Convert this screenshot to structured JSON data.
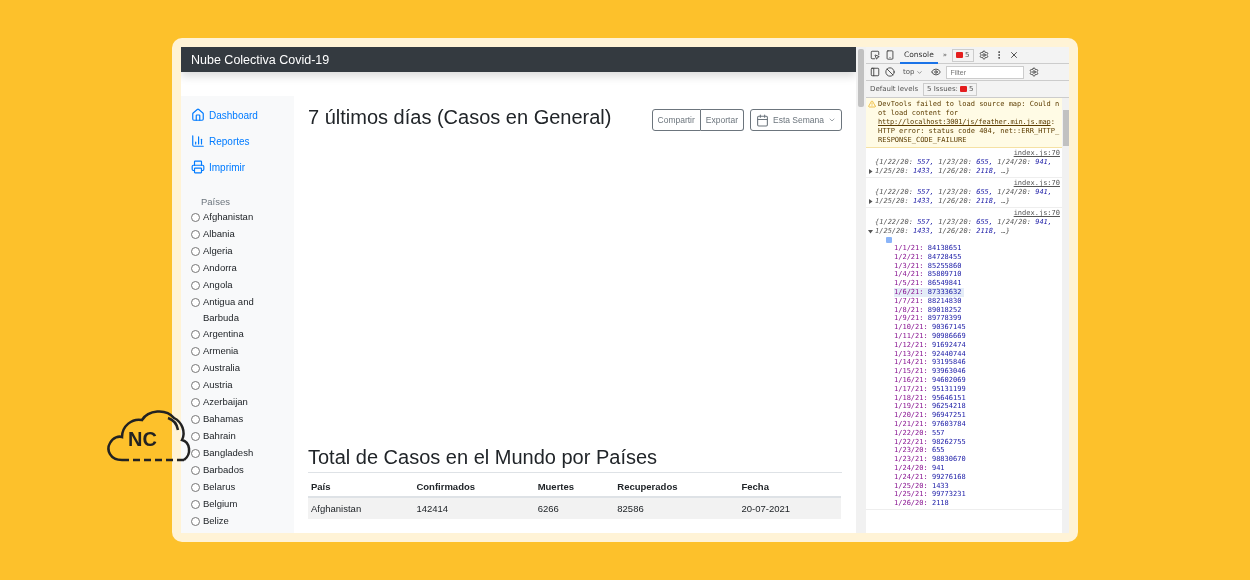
{
  "app": {
    "title": "Nube Colectiva Covid-19",
    "nav": [
      {
        "kind": "home",
        "label": "Dashboard"
      },
      {
        "kind": "chart",
        "label": "Reportes"
      },
      {
        "kind": "print",
        "label": "Imprimir"
      }
    ],
    "countries_heading": "Países",
    "countries": [
      {
        "name": "Afghanistan",
        "selected": false
      },
      {
        "name": "Albania",
        "selected": false
      },
      {
        "name": "Algeria",
        "selected": false
      },
      {
        "name": "Andorra",
        "selected": false
      },
      {
        "name": "Angola",
        "selected": false
      },
      {
        "name": "Antigua and Barbuda",
        "selected": false
      },
      {
        "name": "Argentina",
        "selected": false
      },
      {
        "name": "Armenia",
        "selected": false
      },
      {
        "name": "Australia",
        "selected": false
      },
      {
        "name": "Austria",
        "selected": false
      },
      {
        "name": "Azerbaijan",
        "selected": false
      },
      {
        "name": "Bahamas",
        "selected": false
      },
      {
        "name": "Bahrain",
        "selected": false
      },
      {
        "name": "Bangladesh",
        "selected": false
      },
      {
        "name": "Barbados",
        "selected": false
      },
      {
        "name": "Belarus",
        "selected": false
      },
      {
        "name": "Belgium",
        "selected": false
      },
      {
        "name": "Belize",
        "selected": false
      }
    ],
    "chart_title": "7 últimos días (Casos en General)",
    "buttons": [
      "Compartir",
      "Exportar"
    ],
    "range_dropdown": "Esta Semana",
    "table_title": "Total de Casos en el Mundo por Países",
    "table": {
      "columns": [
        "País",
        "Confirmados",
        "Muertes",
        "Recuperados",
        "Fecha"
      ],
      "rows": [
        [
          "Afghanistan",
          "142414",
          "6266",
          "82586",
          "20-07-2021"
        ]
      ]
    }
  },
  "devtools": {
    "tabs": [
      {
        "label": "Console",
        "selected": true
      }
    ],
    "more_tabs": "»",
    "error_count": "5",
    "context": "top",
    "filter_placeholder": "Filter",
    "levels": "Default levels",
    "issues_label": "5 Issues:",
    "issues_count": "5",
    "warning": {
      "text_before": "DevTools failed to load source map: Could not load content for ",
      "link": "http://localhost:3001/js/feather.min.js.map",
      "text_after": ": HTTP error: status code 404, net::ERR_HTTP_RESPONSE_CODE_FAILURE"
    },
    "logs": [
      {
        "source": "index.js:70",
        "expanded": false,
        "preview": [
          {
            "key": "{1/22/20:",
            "value": "557,"
          },
          {
            "key": "1/23/20:",
            "value": "655,"
          },
          {
            "key": "1/24/20:",
            "value": "941,"
          },
          {
            "key": "1/25/20:",
            "value": "1433,"
          },
          {
            "key": "1/26/20:",
            "value": "2118,"
          }
        ],
        "rest": "…}"
      },
      {
        "source": "index.js:70",
        "expanded": false,
        "preview": [
          {
            "key": "{1/22/20:",
            "value": "557,"
          },
          {
            "key": "1/23/20:",
            "value": "655,"
          },
          {
            "key": "1/24/20:",
            "value": "941,"
          },
          {
            "key": "1/25/20:",
            "value": "1433,"
          },
          {
            "key": "1/26/20:",
            "value": "2118,"
          }
        ],
        "rest": "…}"
      },
      {
        "source": "index.js:70",
        "expanded": true,
        "preview": [
          {
            "key": "{1/22/20:",
            "value": "557,"
          },
          {
            "key": "1/23/20:",
            "value": "655,"
          },
          {
            "key": "1/24/20:",
            "value": "941,"
          },
          {
            "key": "1/25/20:",
            "value": "1433,"
          },
          {
            "key": "1/26/20:",
            "value": "2118,"
          }
        ],
        "rest": "…}"
      }
    ],
    "entries": [
      {
        "key": "1/1/21:",
        "value": "84138651",
        "selected": false
      },
      {
        "key": "1/2/21:",
        "value": "84728455",
        "selected": false
      },
      {
        "key": "1/3/21:",
        "value": "85255860",
        "selected": false
      },
      {
        "key": "1/4/21:",
        "value": "85809710",
        "selected": false
      },
      {
        "key": "1/5/21:",
        "value": "86549841",
        "selected": false
      },
      {
        "key": "1/6/21:",
        "value": "87333632",
        "selected": true
      },
      {
        "key": "1/7/21:",
        "value": "88214830",
        "selected": false
      },
      {
        "key": "1/8/21:",
        "value": "89018252",
        "selected": false
      },
      {
        "key": "1/9/21:",
        "value": "89778399",
        "selected": false
      },
      {
        "key": "1/10/21:",
        "value": "90367145",
        "selected": false
      },
      {
        "key": "1/11/21:",
        "value": "90986669",
        "selected": false
      },
      {
        "key": "1/12/21:",
        "value": "91692474",
        "selected": false
      },
      {
        "key": "1/13/21:",
        "value": "92440744",
        "selected": false
      },
      {
        "key": "1/14/21:",
        "value": "93195846",
        "selected": false
      },
      {
        "key": "1/15/21:",
        "value": "93963046",
        "selected": false
      },
      {
        "key": "1/16/21:",
        "value": "94602069",
        "selected": false
      },
      {
        "key": "1/17/21:",
        "value": "95131199",
        "selected": false
      },
      {
        "key": "1/18/21:",
        "value": "95646151",
        "selected": false
      },
      {
        "key": "1/19/21:",
        "value": "96254218",
        "selected": false
      },
      {
        "key": "1/20/21:",
        "value": "96947251",
        "selected": false
      },
      {
        "key": "1/21/21:",
        "value": "97603784",
        "selected": false
      },
      {
        "key": "1/22/20:",
        "value": "557",
        "selected": false
      },
      {
        "key": "1/22/21:",
        "value": "98262755",
        "selected": false
      },
      {
        "key": "1/23/20:",
        "value": "655",
        "selected": false
      },
      {
        "key": "1/23/21:",
        "value": "98830670",
        "selected": false
      },
      {
        "key": "1/24/20:",
        "value": "941",
        "selected": false
      },
      {
        "key": "1/24/21:",
        "value": "99276168",
        "selected": false
      },
      {
        "key": "1/25/20:",
        "value": "1433",
        "selected": false
      },
      {
        "key": "1/25/21:",
        "value": "99773231",
        "selected": false
      },
      {
        "key": "1/26/20:",
        "value": "2118",
        "selected": false
      }
    ]
  },
  "logo": {
    "text": "NC"
  }
}
